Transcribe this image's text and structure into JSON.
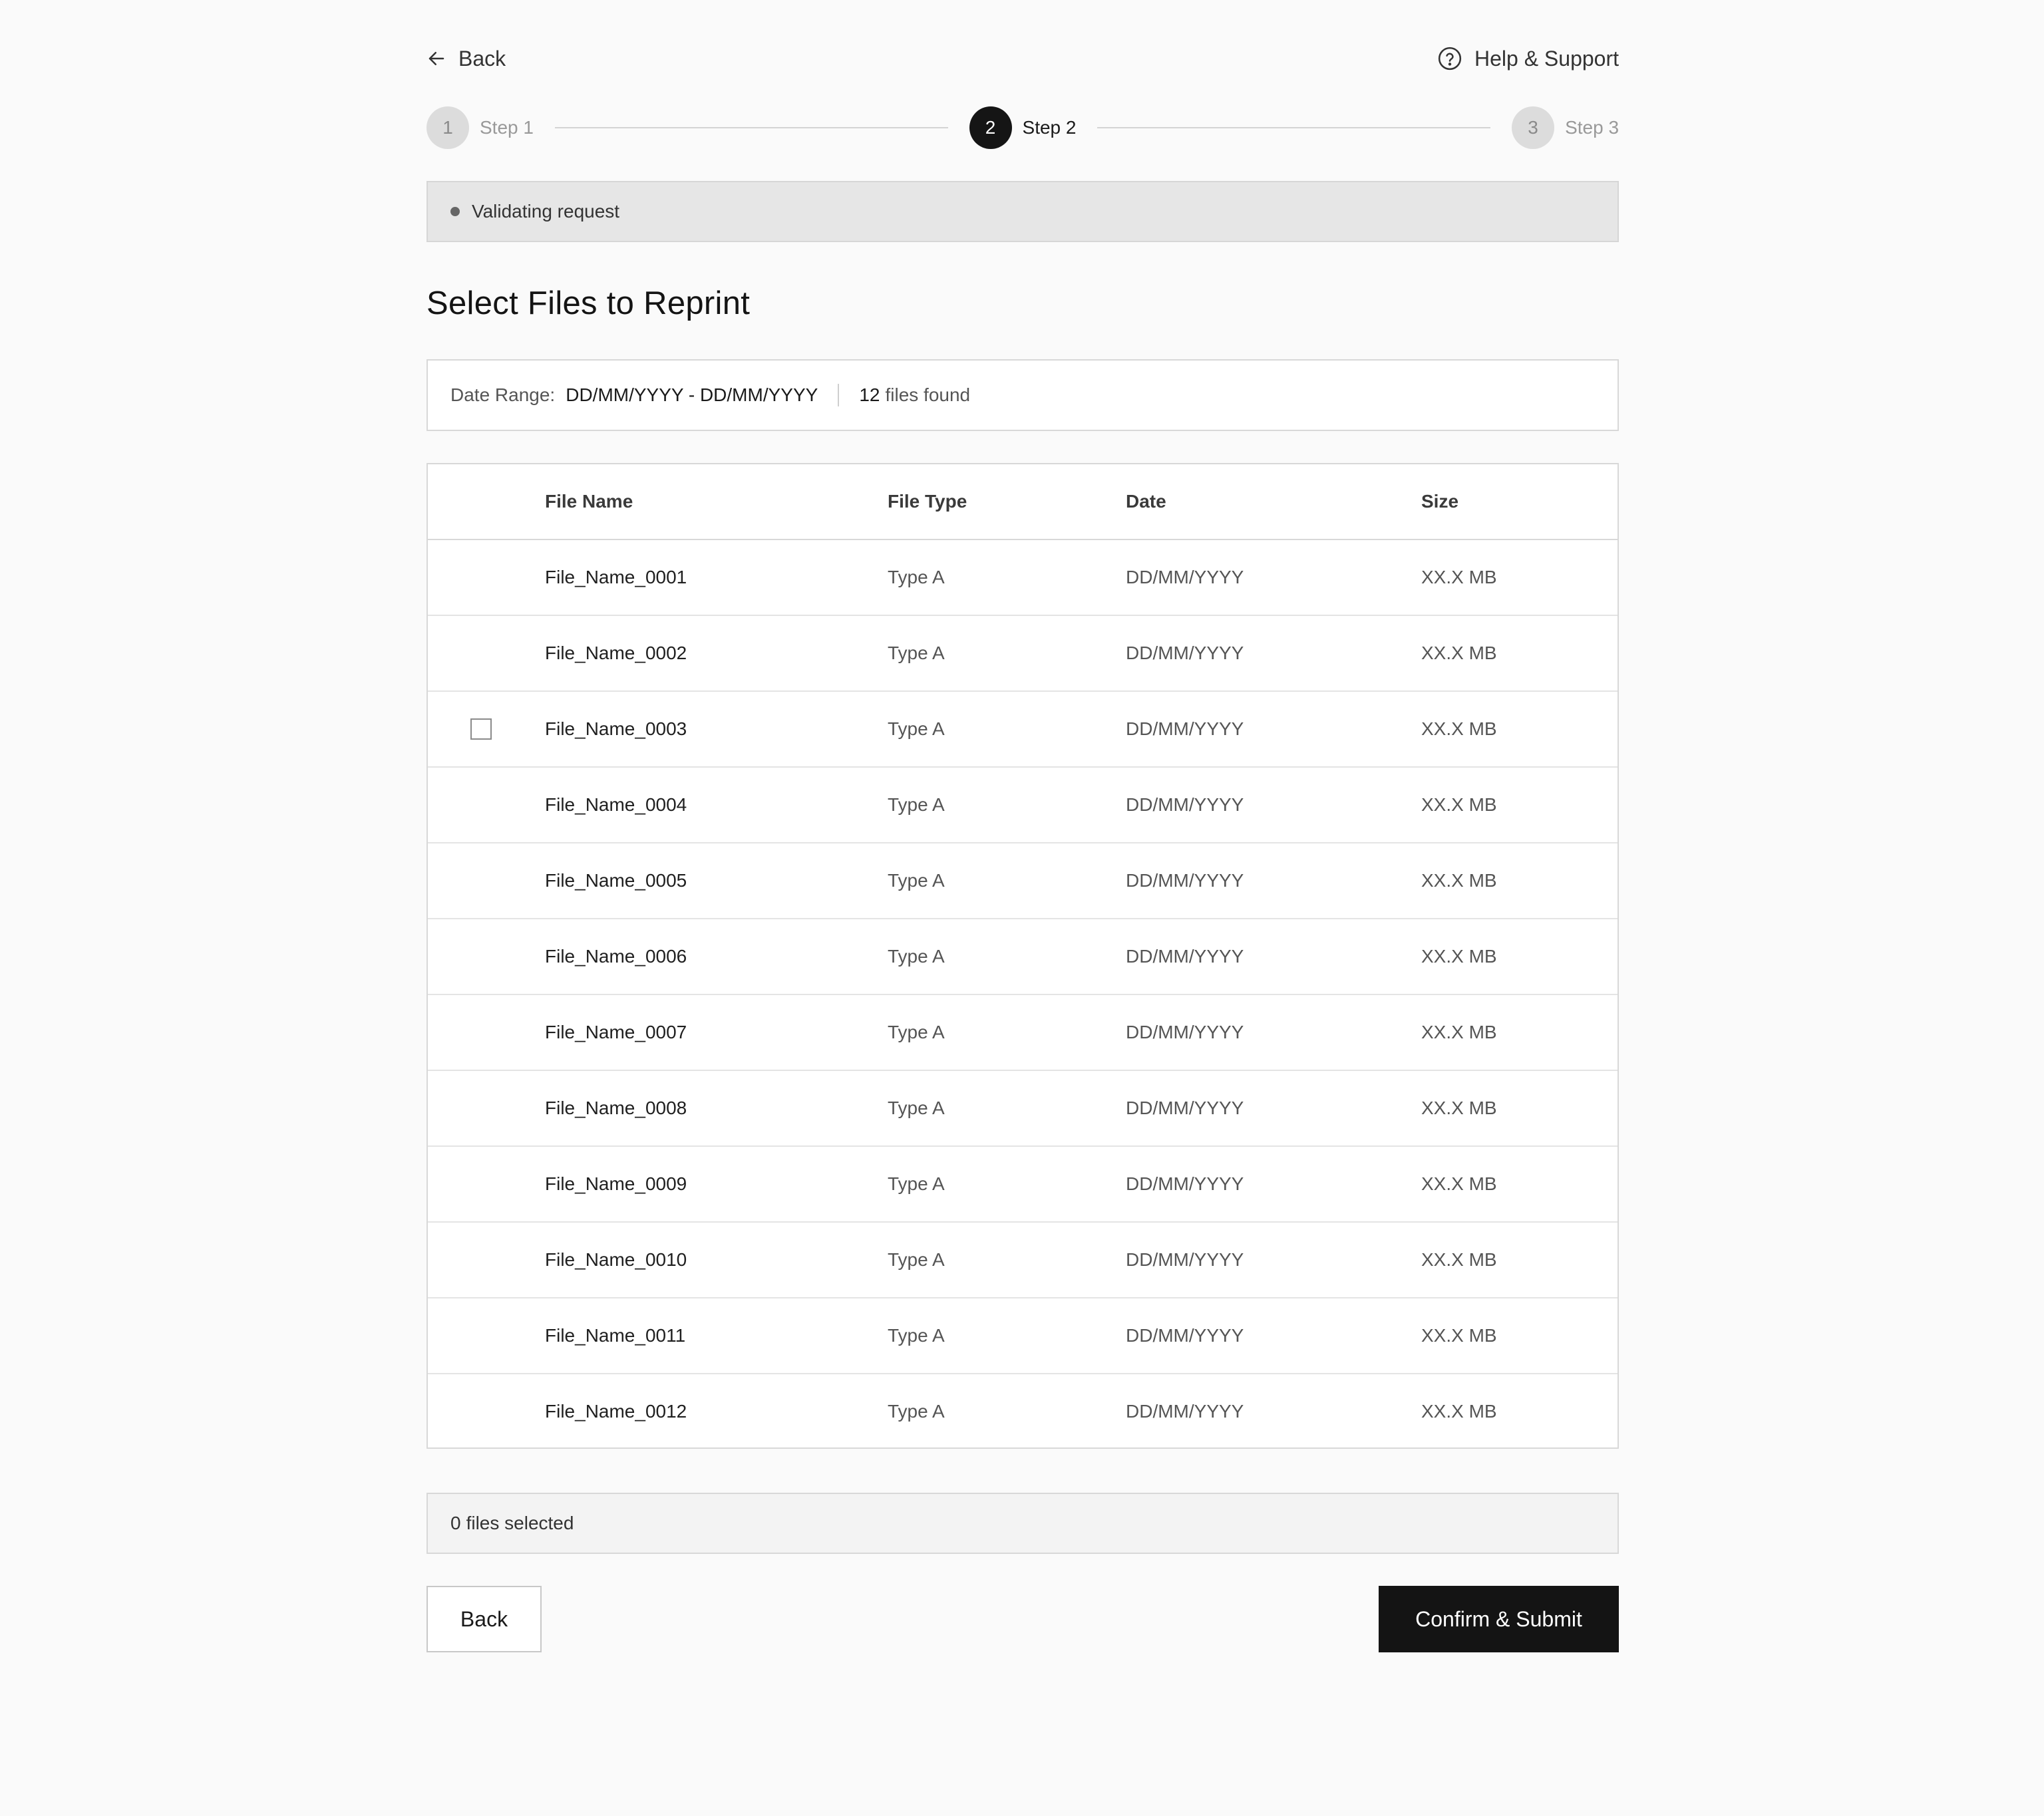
{
  "header": {
    "back_label": "Back",
    "help_label": "Help & Support"
  },
  "stepper": {
    "steps": [
      {
        "number": "1",
        "label": "Step 1",
        "active": false
      },
      {
        "number": "2",
        "label": "Step 2",
        "active": true
      },
      {
        "number": "3",
        "label": "Step 3",
        "active": false
      }
    ]
  },
  "status": {
    "text": "Validating request"
  },
  "page": {
    "title": "Select Files to Reprint"
  },
  "filter": {
    "date_range_label": "Date Range:",
    "date_range_value": "DD/MM/YYYY - DD/MM/YYYY",
    "files_found_count": "12",
    "files_found_text": "files found"
  },
  "table": {
    "columns": [
      "File Name",
      "File Type",
      "Date",
      "Size"
    ],
    "rows": [
      {
        "name": "File_Name_0001",
        "type": "Type A",
        "date": "DD/MM/YYYY",
        "size": "XX.X MB",
        "checkbox_visible": false
      },
      {
        "name": "File_Name_0002",
        "type": "Type A",
        "date": "DD/MM/YYYY",
        "size": "XX.X MB",
        "checkbox_visible": false
      },
      {
        "name": "File_Name_0003",
        "type": "Type A",
        "date": "DD/MM/YYYY",
        "size": "XX.X MB",
        "checkbox_visible": true
      },
      {
        "name": "File_Name_0004",
        "type": "Type A",
        "date": "DD/MM/YYYY",
        "size": "XX.X MB",
        "checkbox_visible": false
      },
      {
        "name": "File_Name_0005",
        "type": "Type A",
        "date": "DD/MM/YYYY",
        "size": "XX.X MB",
        "checkbox_visible": false
      },
      {
        "name": "File_Name_0006",
        "type": "Type A",
        "date": "DD/MM/YYYY",
        "size": "XX.X MB",
        "checkbox_visible": false
      },
      {
        "name": "File_Name_0007",
        "type": "Type A",
        "date": "DD/MM/YYYY",
        "size": "XX.X MB",
        "checkbox_visible": false
      },
      {
        "name": "File_Name_0008",
        "type": "Type A",
        "date": "DD/MM/YYYY",
        "size": "XX.X MB",
        "checkbox_visible": false
      },
      {
        "name": "File_Name_0009",
        "type": "Type A",
        "date": "DD/MM/YYYY",
        "size": "XX.X MB",
        "checkbox_visible": false
      },
      {
        "name": "File_Name_0010",
        "type": "Type A",
        "date": "DD/MM/YYYY",
        "size": "XX.X MB",
        "checkbox_visible": false
      },
      {
        "name": "File_Name_0011",
        "type": "Type A",
        "date": "DD/MM/YYYY",
        "size": "XX.X MB",
        "checkbox_visible": false
      },
      {
        "name": "File_Name_0012",
        "type": "Type A",
        "date": "DD/MM/YYYY",
        "size": "XX.X MB",
        "checkbox_visible": false
      }
    ]
  },
  "selection": {
    "count": "0",
    "text": "files selected"
  },
  "actions": {
    "back_label": "Back",
    "submit_label": "Confirm & Submit"
  },
  "icons": {
    "back": "arrow-left-icon",
    "help": "question-circle-icon",
    "status": "dot-icon",
    "checkbox": "checkbox-icon"
  }
}
